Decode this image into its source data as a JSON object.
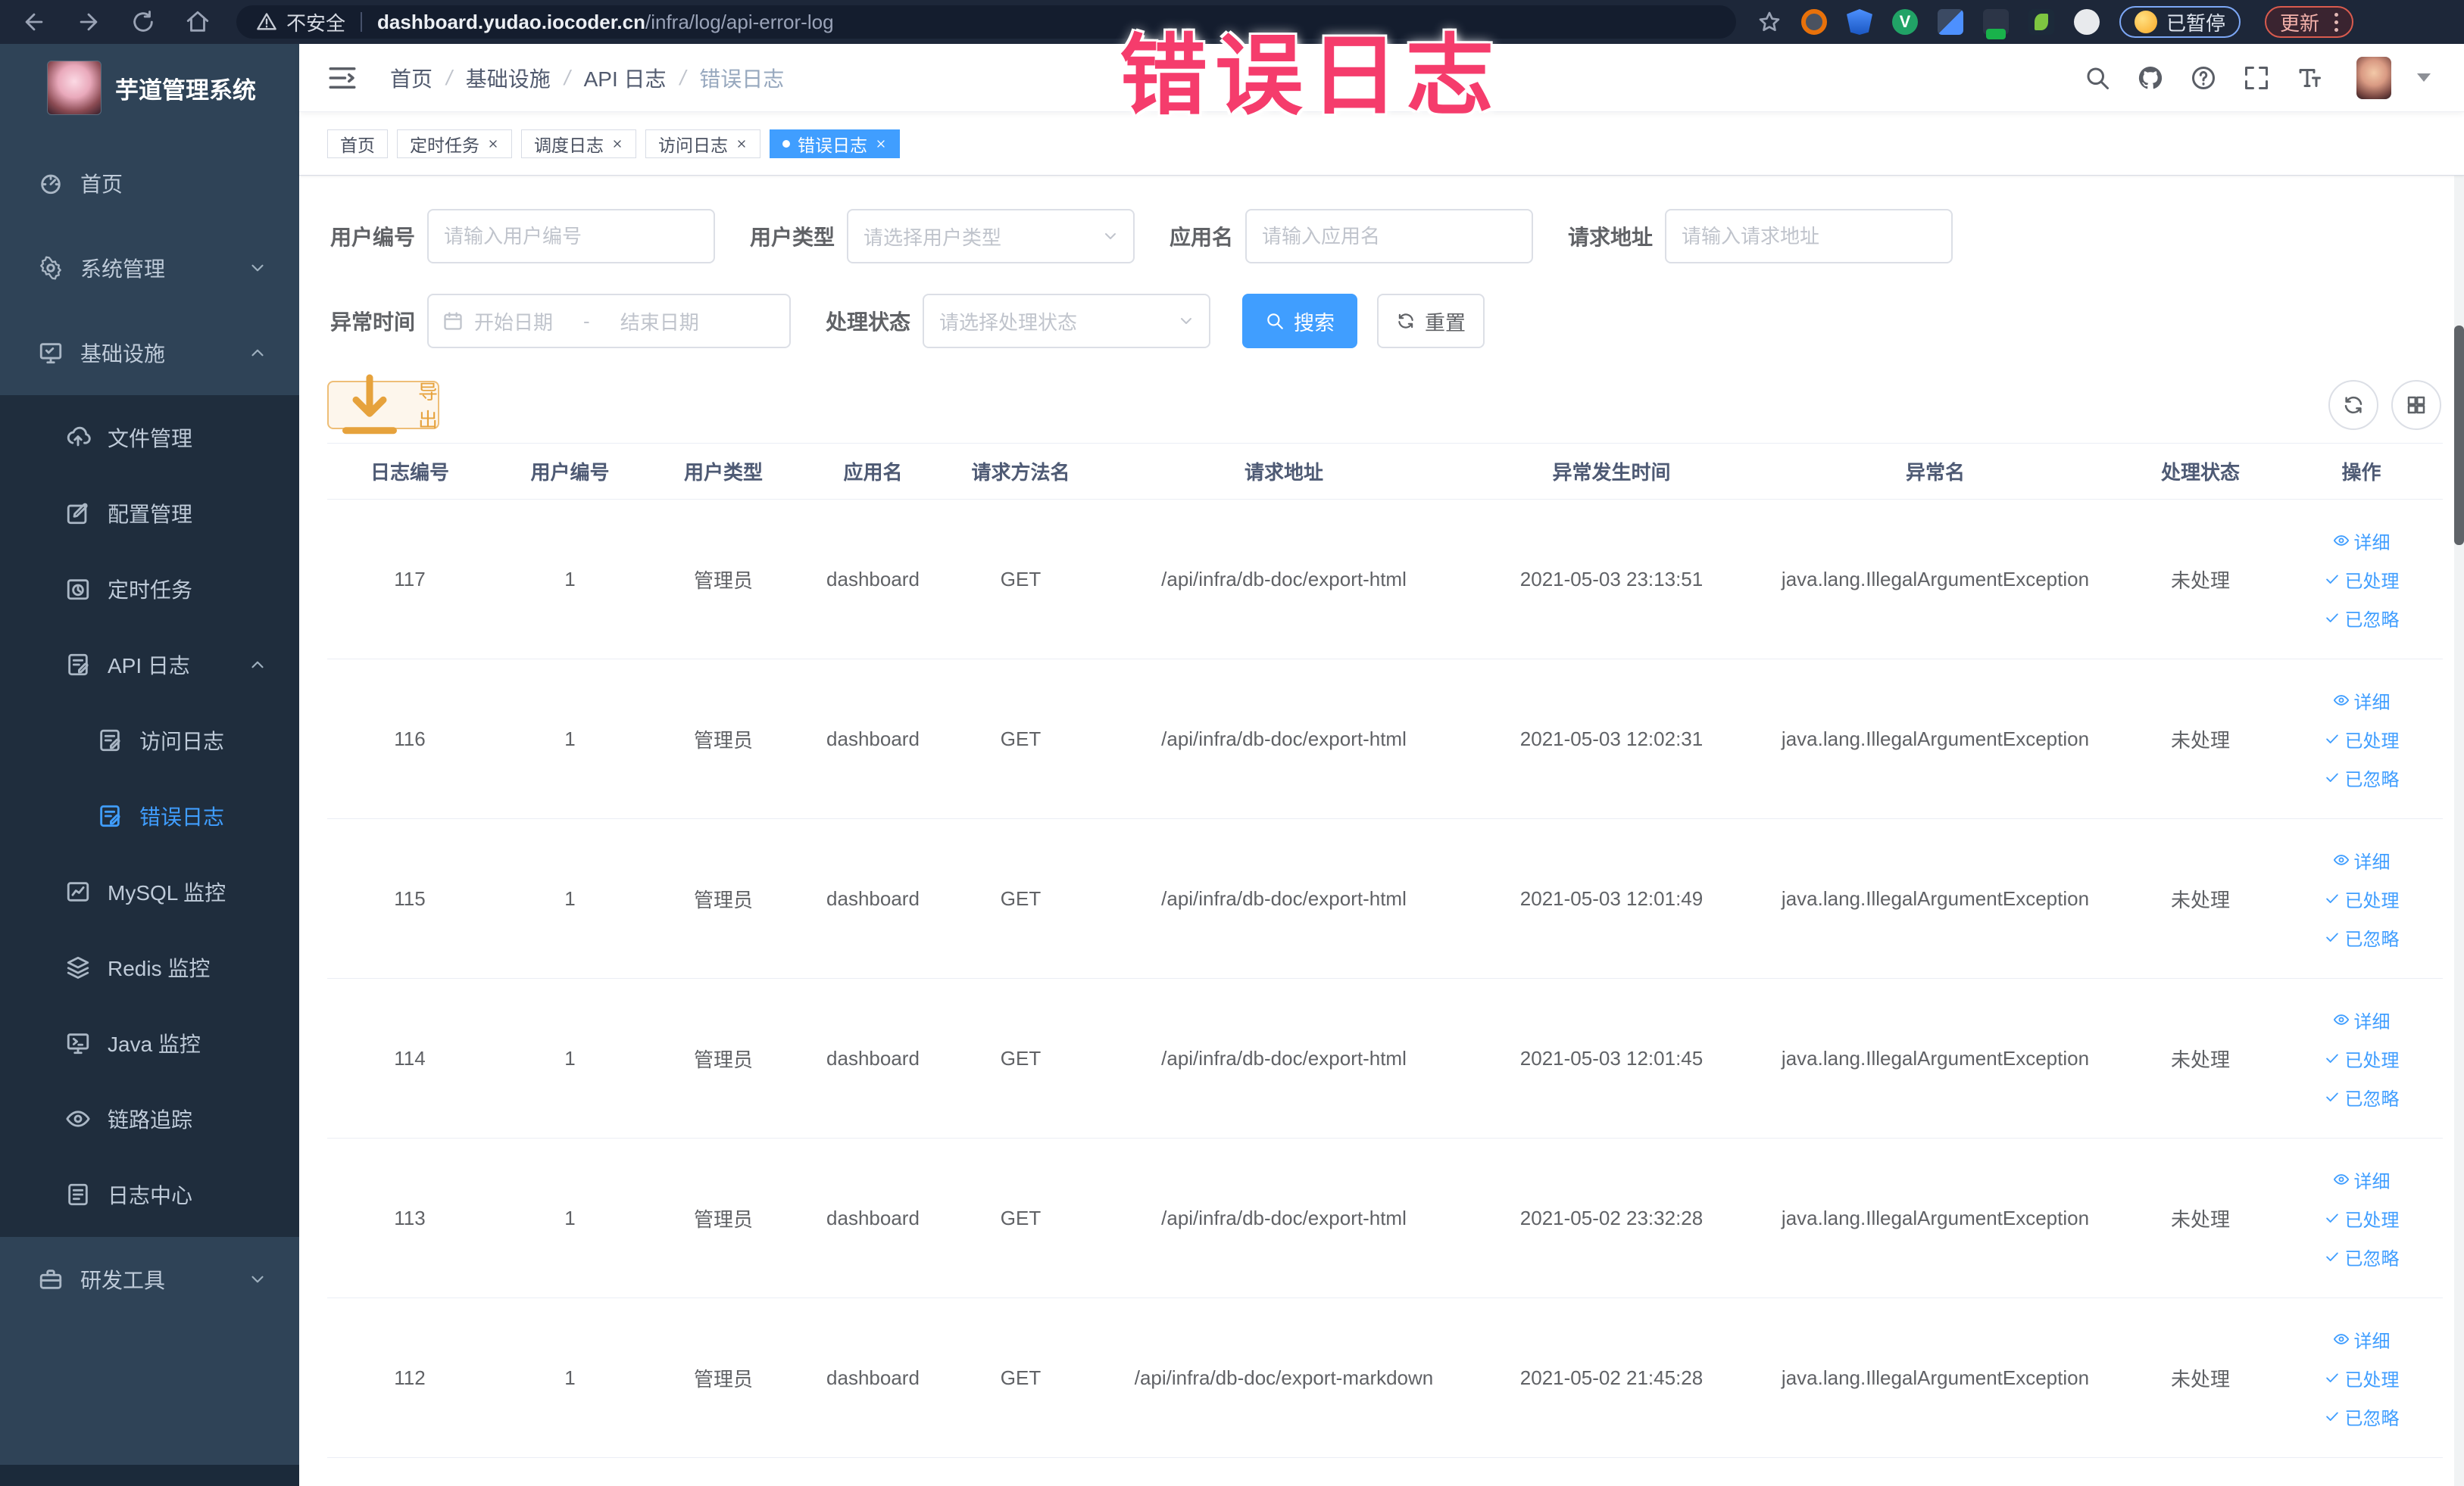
{
  "browser": {
    "security_label": "不安全",
    "url_domain": "dashboard.yudao.iocoder.cn",
    "url_path": "/infra/log/api-error-log",
    "profile_badge": "已暂停",
    "update_label": "更新",
    "extension_icons": [
      "orange-ring-extension-icon",
      "blue-shield-extension-icon",
      "green-badge-extension-icon",
      "blue-grid-extension-icon",
      "switch-on-extension-icon",
      "green-sprout-extension-icon",
      "white-pin-extension-icon"
    ]
  },
  "annotation": {
    "title": "错误日志"
  },
  "sidebar": {
    "logo_title": "芋道管理系统",
    "items": [
      {
        "label": "首页",
        "icon": "dashboard",
        "level": 1,
        "zone": "top"
      },
      {
        "label": "系统管理",
        "icon": "gear",
        "level": 1,
        "zone": "top",
        "chevron": "down"
      },
      {
        "label": "基础设施",
        "icon": "monitor",
        "level": 1,
        "zone": "top",
        "chevron": "up"
      },
      {
        "label": "文件管理",
        "icon": "upload",
        "level": 2,
        "zone": "sub"
      },
      {
        "label": "配置管理",
        "icon": "edit",
        "level": 2,
        "zone": "sub"
      },
      {
        "label": "定时任务",
        "icon": "timer",
        "level": 2,
        "zone": "sub"
      },
      {
        "label": "API 日志",
        "icon": "log",
        "level": 2,
        "zone": "sub",
        "chevron": "up"
      },
      {
        "label": "访问日志",
        "icon": "log",
        "level": 3,
        "zone": "sub"
      },
      {
        "label": "错误日志",
        "icon": "log",
        "level": 3,
        "zone": "sub",
        "active": true
      },
      {
        "label": "MySQL 监控",
        "icon": "chart",
        "level": 2,
        "zone": "sub"
      },
      {
        "label": "Redis 监控",
        "icon": "layers",
        "level": 2,
        "zone": "sub"
      },
      {
        "label": "Java 监控",
        "icon": "java",
        "level": 2,
        "zone": "sub"
      },
      {
        "label": "链路追踪",
        "icon": "eye",
        "level": 2,
        "zone": "sub"
      },
      {
        "label": "日志中心",
        "icon": "logcenter",
        "level": 2,
        "zone": "sub"
      },
      {
        "label": "研发工具",
        "icon": "tool",
        "level": 1,
        "zone": "bottom",
        "chevron": "down"
      }
    ]
  },
  "navbar": {
    "breadcrumb": [
      "首页",
      "基础设施",
      "API 日志",
      "错误日志"
    ],
    "separator": "/"
  },
  "tabs": [
    {
      "label": "首页",
      "closable": false,
      "active": false
    },
    {
      "label": "定时任务",
      "closable": true,
      "active": false
    },
    {
      "label": "调度日志",
      "closable": true,
      "active": false
    },
    {
      "label": "访问日志",
      "closable": true,
      "active": false
    },
    {
      "label": "错误日志",
      "closable": true,
      "active": true
    }
  ],
  "filters": {
    "user_id": {
      "label": "用户编号",
      "placeholder": "请输入用户编号"
    },
    "user_type": {
      "label": "用户类型",
      "placeholder": "请选择用户类型"
    },
    "app_name": {
      "label": "应用名",
      "placeholder": "请输入应用名"
    },
    "request_url": {
      "label": "请求地址",
      "placeholder": "请输入请求地址"
    },
    "exception_time": {
      "label": "异常时间",
      "start_placeholder": "开始日期",
      "separator": "-",
      "end_placeholder": "结束日期"
    },
    "process_status": {
      "label": "处理状态",
      "placeholder": "请选择处理状态"
    },
    "search_label": "搜索",
    "reset_label": "重置"
  },
  "toolbar": {
    "export_label": "导出"
  },
  "table": {
    "columns": [
      "日志编号",
      "用户编号",
      "用户类型",
      "应用名",
      "请求方法名",
      "请求地址",
      "异常发生时间",
      "异常名",
      "处理状态",
      "操作"
    ],
    "field_order": [
      "id",
      "user_id",
      "user_type",
      "app",
      "method",
      "url",
      "time",
      "exception",
      "status"
    ],
    "rows": [
      {
        "id": "117",
        "user_id": "1",
        "user_type": "管理员",
        "app": "dashboard",
        "method": "GET",
        "url": "/api/infra/db-doc/export-html",
        "time": "2021-05-03 23:13:51",
        "exception": "java.lang.IllegalArgumentException",
        "status": "未处理"
      },
      {
        "id": "116",
        "user_id": "1",
        "user_type": "管理员",
        "app": "dashboard",
        "method": "GET",
        "url": "/api/infra/db-doc/export-html",
        "time": "2021-05-03 12:02:31",
        "exception": "java.lang.IllegalArgumentException",
        "status": "未处理"
      },
      {
        "id": "115",
        "user_id": "1",
        "user_type": "管理员",
        "app": "dashboard",
        "method": "GET",
        "url": "/api/infra/db-doc/export-html",
        "time": "2021-05-03 12:01:49",
        "exception": "java.lang.IllegalArgumentException",
        "status": "未处理"
      },
      {
        "id": "114",
        "user_id": "1",
        "user_type": "管理员",
        "app": "dashboard",
        "method": "GET",
        "url": "/api/infra/db-doc/export-html",
        "time": "2021-05-03 12:01:45",
        "exception": "java.lang.IllegalArgumentException",
        "status": "未处理"
      },
      {
        "id": "113",
        "user_id": "1",
        "user_type": "管理员",
        "app": "dashboard",
        "method": "GET",
        "url": "/api/infra/db-doc/export-html",
        "time": "2021-05-02 23:32:28",
        "exception": "java.lang.IllegalArgumentException",
        "status": "未处理"
      },
      {
        "id": "112",
        "user_id": "1",
        "user_type": "管理员",
        "app": "dashboard",
        "method": "GET",
        "url": "/api/infra/db-doc/export-markdown",
        "time": "2021-05-02 21:45:28",
        "exception": "java.lang.IllegalArgumentException",
        "status": "未处理"
      }
    ],
    "row_actions": [
      "详细",
      "已处理",
      "已忽略"
    ]
  },
  "colors": {
    "accent": "#409eff",
    "sidebar_bg": "#2f4357",
    "submenu_bg": "#1f2d3d",
    "warning": "#e6a23c",
    "annotation_pink": "#f53c6c"
  }
}
